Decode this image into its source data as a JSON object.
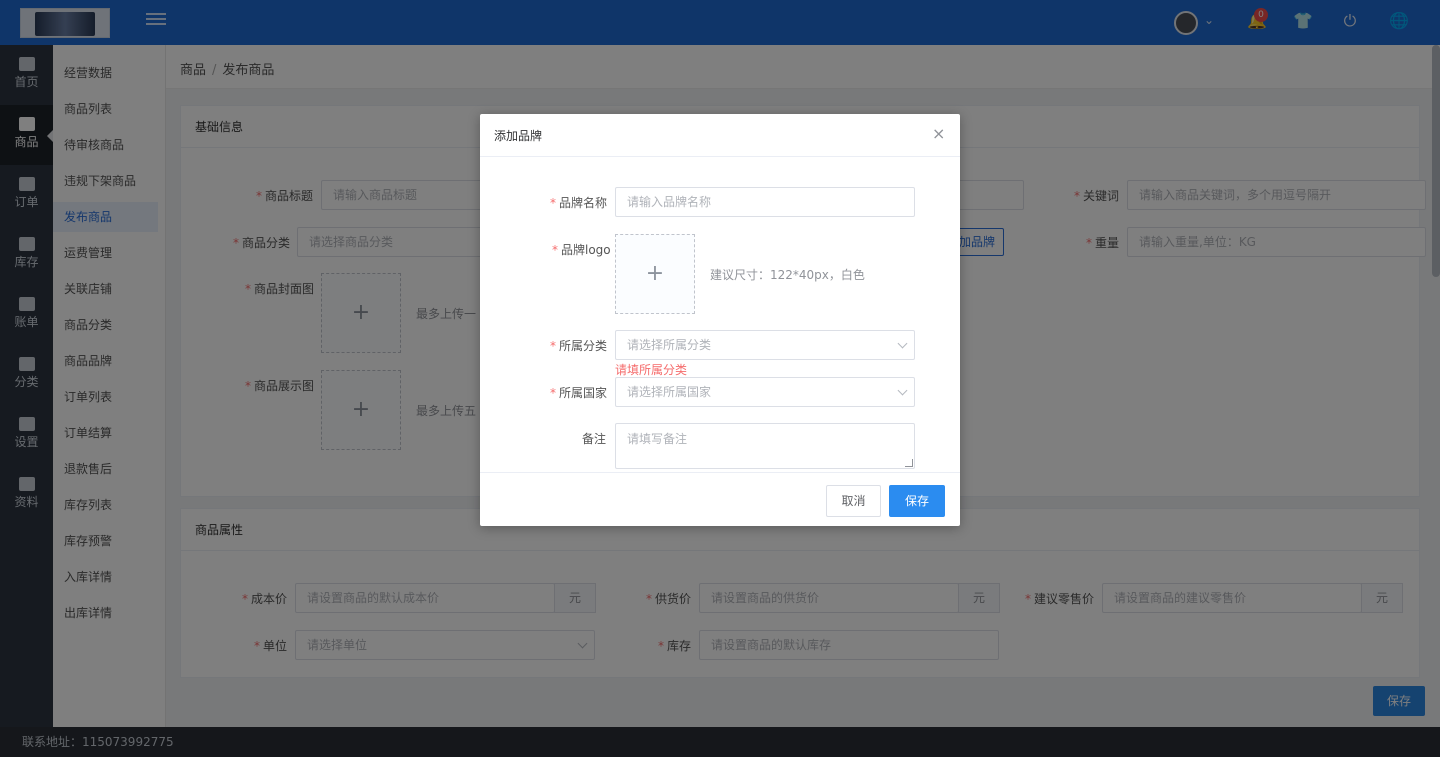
{
  "header": {
    "notification_count": "0",
    "icons": [
      "menu-icon",
      "avatar",
      "bell-icon",
      "shirt-icon",
      "power-icon",
      "globe-icon"
    ]
  },
  "iconbar": [
    {
      "label": "首页",
      "icon": "home-icon"
    },
    {
      "label": "商品",
      "icon": "goods-icon",
      "active": true
    },
    {
      "label": "订单",
      "icon": "order-icon"
    },
    {
      "label": "库存",
      "icon": "pie-chart-icon"
    },
    {
      "label": "账单",
      "icon": "bill-icon"
    },
    {
      "label": "分类",
      "icon": "category-icon"
    },
    {
      "label": "设置",
      "icon": "puzzle-icon"
    },
    {
      "label": "资料",
      "icon": "image-icon"
    }
  ],
  "submenu": [
    "经营数据",
    "商品列表",
    "待审核商品",
    "违规下架商品",
    "发布商品",
    "运费管理",
    "关联店铺",
    "商品分类",
    "商品品牌",
    "订单列表",
    "订单结算",
    "退款售后",
    "库存列表",
    "库存预警",
    "入库详情",
    "出库详情"
  ],
  "breadcrumb": {
    "root": "商品",
    "current": "发布商品",
    "separator": "/"
  },
  "basic_info": {
    "title": "基础信息",
    "product_title_label": "商品标题",
    "product_title_placeholder": "请输入商品标题",
    "keyword_label": "关键词",
    "keyword_placeholder": "请输入商品关键词，多个用逗号隔开",
    "category_label": "商品分类",
    "category_placeholder": "请选择商品分类",
    "add_brand_button": "加品牌",
    "weight_label": "重量",
    "weight_placeholder": "请输入重量,单位：KG",
    "cover_label": "商品封面图",
    "cover_hint": "最多上传一张",
    "gallery_label": "商品展示图",
    "gallery_hint": "最多上传五张"
  },
  "attributes": {
    "title": "商品属性",
    "cost_label": "成本价",
    "cost_placeholder": "请设置商品的默认成本价",
    "supply_label": "供货价",
    "supply_placeholder": "请设置商品的供货价",
    "retail_label": "建议零售价",
    "retail_placeholder": "请设置商品的建议零售价",
    "unit_suffix": "元",
    "unit_label": "单位",
    "unit_placeholder": "请选择单位",
    "stock_label": "库存",
    "stock_placeholder": "请设置商品的默认库存"
  },
  "page_save": "保存",
  "footer": {
    "contact": "联系地址：115073992775"
  },
  "dialog": {
    "title": "添加品牌",
    "close": "×",
    "brand_name_label": "品牌名称",
    "brand_name_placeholder": "请输入品牌名称",
    "brand_logo_label": "品牌logo",
    "logo_hint": "建议尺寸：122*40px，白色",
    "plus": "+",
    "category_label": "所属分类",
    "category_placeholder": "请选择所属分类",
    "category_error": "请填所属分类",
    "country_label": "所属国家",
    "country_placeholder": "请选择所属国家",
    "remark_label": "备注",
    "remark_placeholder": "请填写备注",
    "cancel": "取消",
    "save": "保存"
  },
  "colors": {
    "primary": "#1e6ad2",
    "sidebar": "#2c3440",
    "error": "#f56c6c",
    "button": "#2b8cf0"
  }
}
